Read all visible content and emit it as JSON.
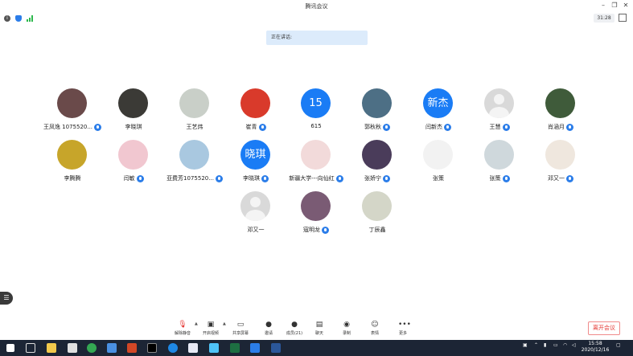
{
  "window": {
    "title": "腾讯会议",
    "timer": "31:28"
  },
  "status": {
    "speaking": "正在讲话:"
  },
  "participants": [
    {
      "name": "王凤逸 1075520...",
      "avatar": "photo",
      "color": "#6a4a4a",
      "mic": true
    },
    {
      "name": "李晓琪",
      "avatar": "photo",
      "color": "#3b3a36",
      "mic": false
    },
    {
      "name": "王艺炜",
      "avatar": "photo",
      "color": "#c9cfc8",
      "mic": false
    },
    {
      "name": "崔青",
      "avatar": "photo",
      "color": "#d93a2b",
      "mic": true
    },
    {
      "name": "615",
      "avatar": "text",
      "text": "15",
      "mic": false
    },
    {
      "name": "郭秋秋",
      "avatar": "photo",
      "color": "#4d6f85",
      "mic": true
    },
    {
      "name": "闫新杰",
      "avatar": "text",
      "text": "新杰",
      "mic": true
    },
    {
      "name": "王慧",
      "avatar": "grey",
      "mic": true
    },
    {
      "name": "肖涵月",
      "avatar": "photo",
      "color": "#3f5b3a",
      "mic": true
    },
    {
      "name": "李腾腾",
      "avatar": "photo",
      "color": "#c7a52a",
      "mic": false
    },
    {
      "name": "闫敏",
      "avatar": "photo",
      "color": "#f1c7d0",
      "mic": true
    },
    {
      "name": "亚费芳1075520...",
      "avatar": "photo",
      "color": "#a9c8e0",
      "mic": true
    },
    {
      "name": "李晓琪",
      "avatar": "text",
      "text": "晓琪",
      "mic": true
    },
    {
      "name": "新疆大学---向仙红",
      "avatar": "photo",
      "color": "#f2dada",
      "mic": true
    },
    {
      "name": "张娇宁",
      "avatar": "photo",
      "color": "#4a3c5a",
      "mic": true
    },
    {
      "name": "张策",
      "avatar": "photo",
      "color": "#f2f2f2",
      "mic": false
    },
    {
      "name": "张策",
      "avatar": "photo",
      "color": "#cfd8dc",
      "mic": true
    },
    {
      "name": "邓又一",
      "avatar": "photo",
      "color": "#efe7de",
      "mic": true
    },
    {
      "name": "邓又一",
      "avatar": "grey",
      "mic": false
    },
    {
      "name": "寇明龙",
      "avatar": "photo",
      "color": "#7a5b74",
      "mic": true
    },
    {
      "name": "丁辰鑫",
      "avatar": "photo",
      "color": "#d4d6c8",
      "mic": false
    }
  ],
  "toolbar": {
    "unmute": "解除静音",
    "video": "开启视频",
    "share": "共享屏幕",
    "invite": "邀请",
    "members": "成员(21)",
    "chat": "聊天",
    "record": "录制",
    "reactions": "表情",
    "more": "更多",
    "leave": "离开会议"
  },
  "taskbar": {
    "time": "15:58",
    "date": "2020/12/16"
  },
  "colors": {
    "accent": "#1a7cf5",
    "leave": "#e53935",
    "taskbar": "#1c2535"
  }
}
